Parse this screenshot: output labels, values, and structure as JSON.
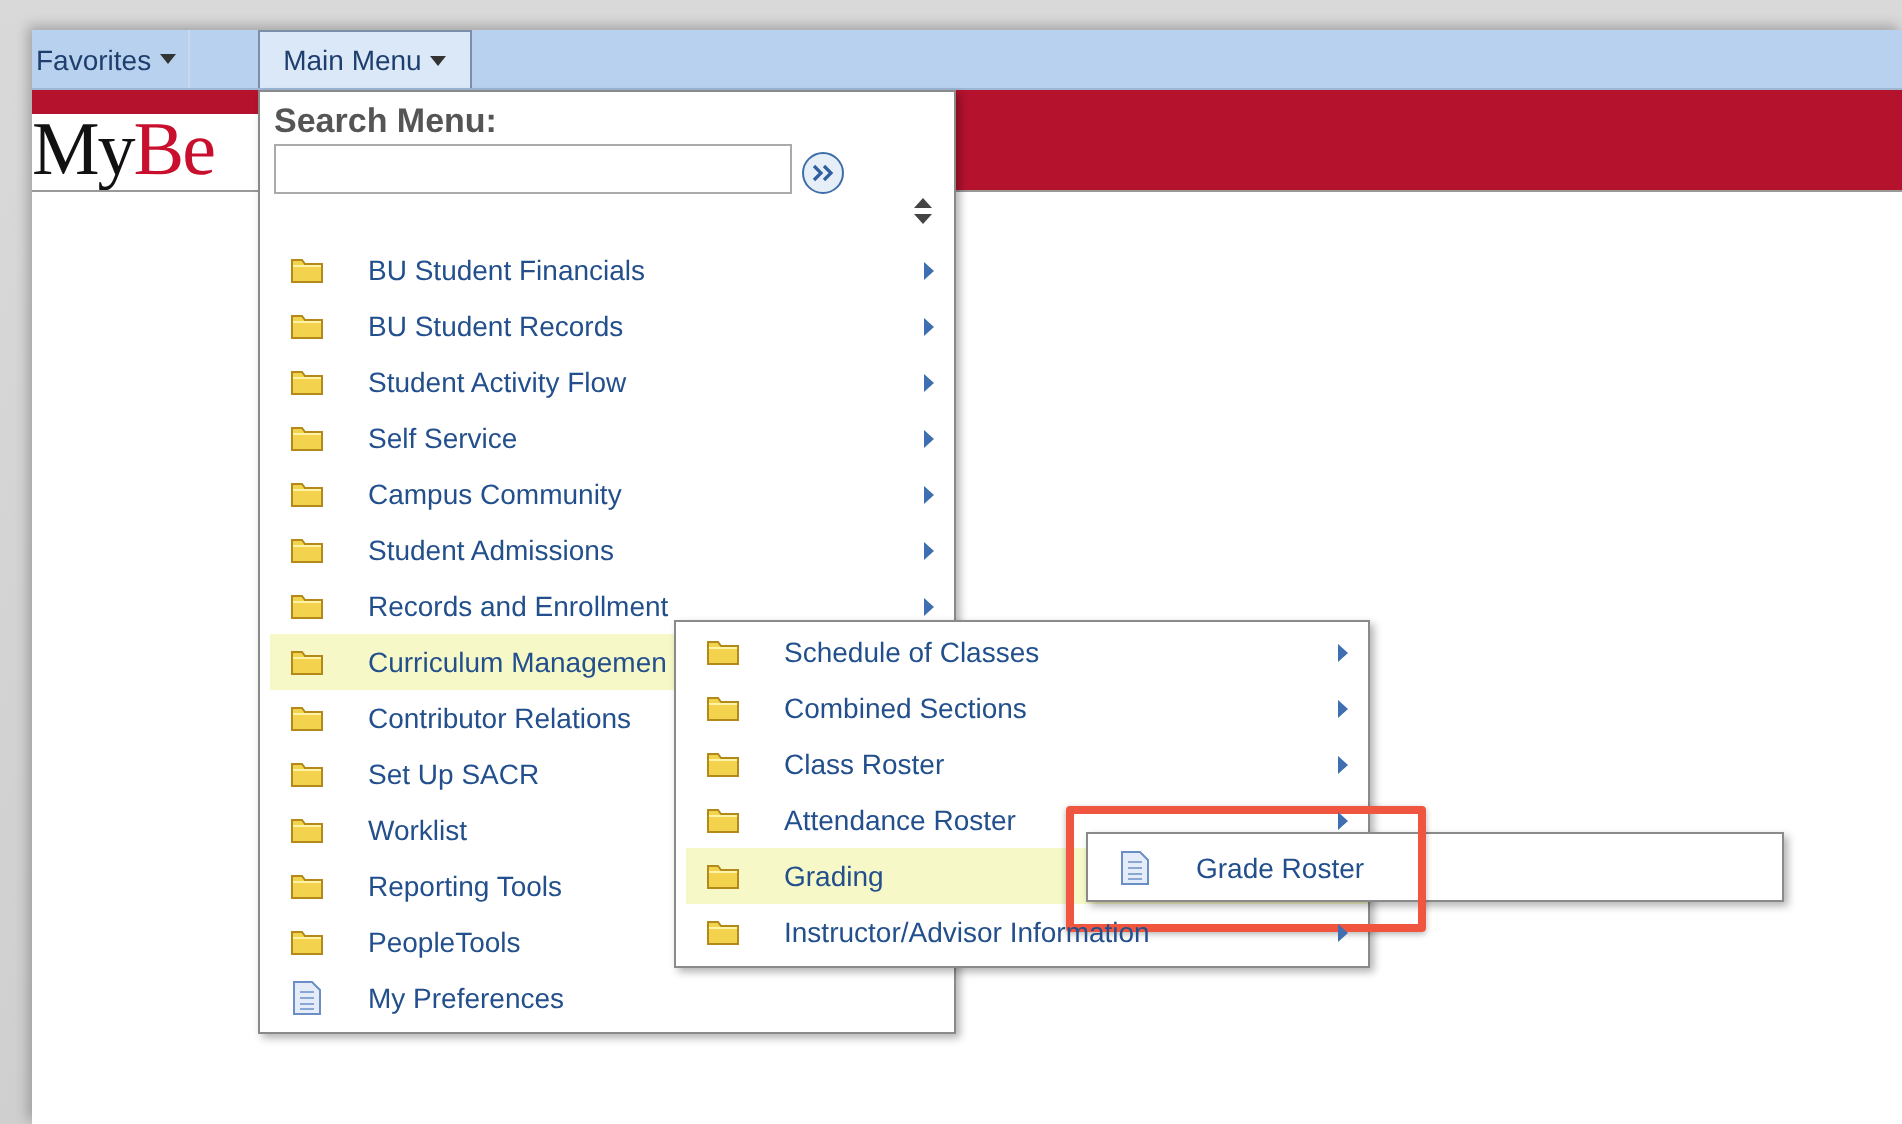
{
  "nav": [
    {
      "label": "Favorites",
      "selected": false
    },
    {
      "label": "Main Menu",
      "selected": true
    }
  ],
  "logo": {
    "part_1": "My",
    "part_2": "Be"
  },
  "main_menu": {
    "search_label": "Search Menu:",
    "items": [
      {
        "label": "BU Student Financials",
        "kind": "folder",
        "arrow": true,
        "selected": false
      },
      {
        "label": "BU Student Records",
        "kind": "folder",
        "arrow": true,
        "selected": false
      },
      {
        "label": "Student Activity Flow",
        "kind": "folder",
        "arrow": true,
        "selected": false
      },
      {
        "label": "Self Service",
        "kind": "folder",
        "arrow": true,
        "selected": false
      },
      {
        "label": "Campus Community",
        "kind": "folder",
        "arrow": true,
        "selected": false
      },
      {
        "label": "Student Admissions",
        "kind": "folder",
        "arrow": true,
        "selected": false
      },
      {
        "label": "Records and Enrollment",
        "kind": "folder",
        "arrow": true,
        "selected": false
      },
      {
        "label": "Curriculum Managemen",
        "kind": "folder",
        "arrow": false,
        "selected": true
      },
      {
        "label": "Contributor Relations",
        "kind": "folder",
        "arrow": false,
        "selected": false
      },
      {
        "label": "Set Up SACR",
        "kind": "folder",
        "arrow": false,
        "selected": false
      },
      {
        "label": "Worklist",
        "kind": "folder",
        "arrow": false,
        "selected": false
      },
      {
        "label": "Reporting Tools",
        "kind": "folder",
        "arrow": false,
        "selected": false
      },
      {
        "label": "PeopleTools",
        "kind": "folder",
        "arrow": false,
        "selected": false
      },
      {
        "label": "My Preferences",
        "kind": "page",
        "arrow": false,
        "selected": false
      }
    ]
  },
  "submenu": {
    "items": [
      {
        "label": "Schedule of Classes",
        "kind": "folder",
        "arrow": true,
        "selected": false
      },
      {
        "label": "Combined Sections",
        "kind": "folder",
        "arrow": true,
        "selected": false
      },
      {
        "label": "Class Roster",
        "kind": "folder",
        "arrow": true,
        "selected": false
      },
      {
        "label": "Attendance Roster",
        "kind": "folder",
        "arrow": true,
        "selected": false
      },
      {
        "label": "Grading",
        "kind": "folder",
        "arrow": false,
        "selected": true
      },
      {
        "label": "Instructor/Advisor Information",
        "kind": "folder",
        "arrow": true,
        "selected": false
      }
    ]
  },
  "grading_menu": {
    "items": [
      {
        "label": "Grade Roster",
        "kind": "page",
        "arrow": false,
        "selected": false,
        "annotated": true
      }
    ]
  }
}
